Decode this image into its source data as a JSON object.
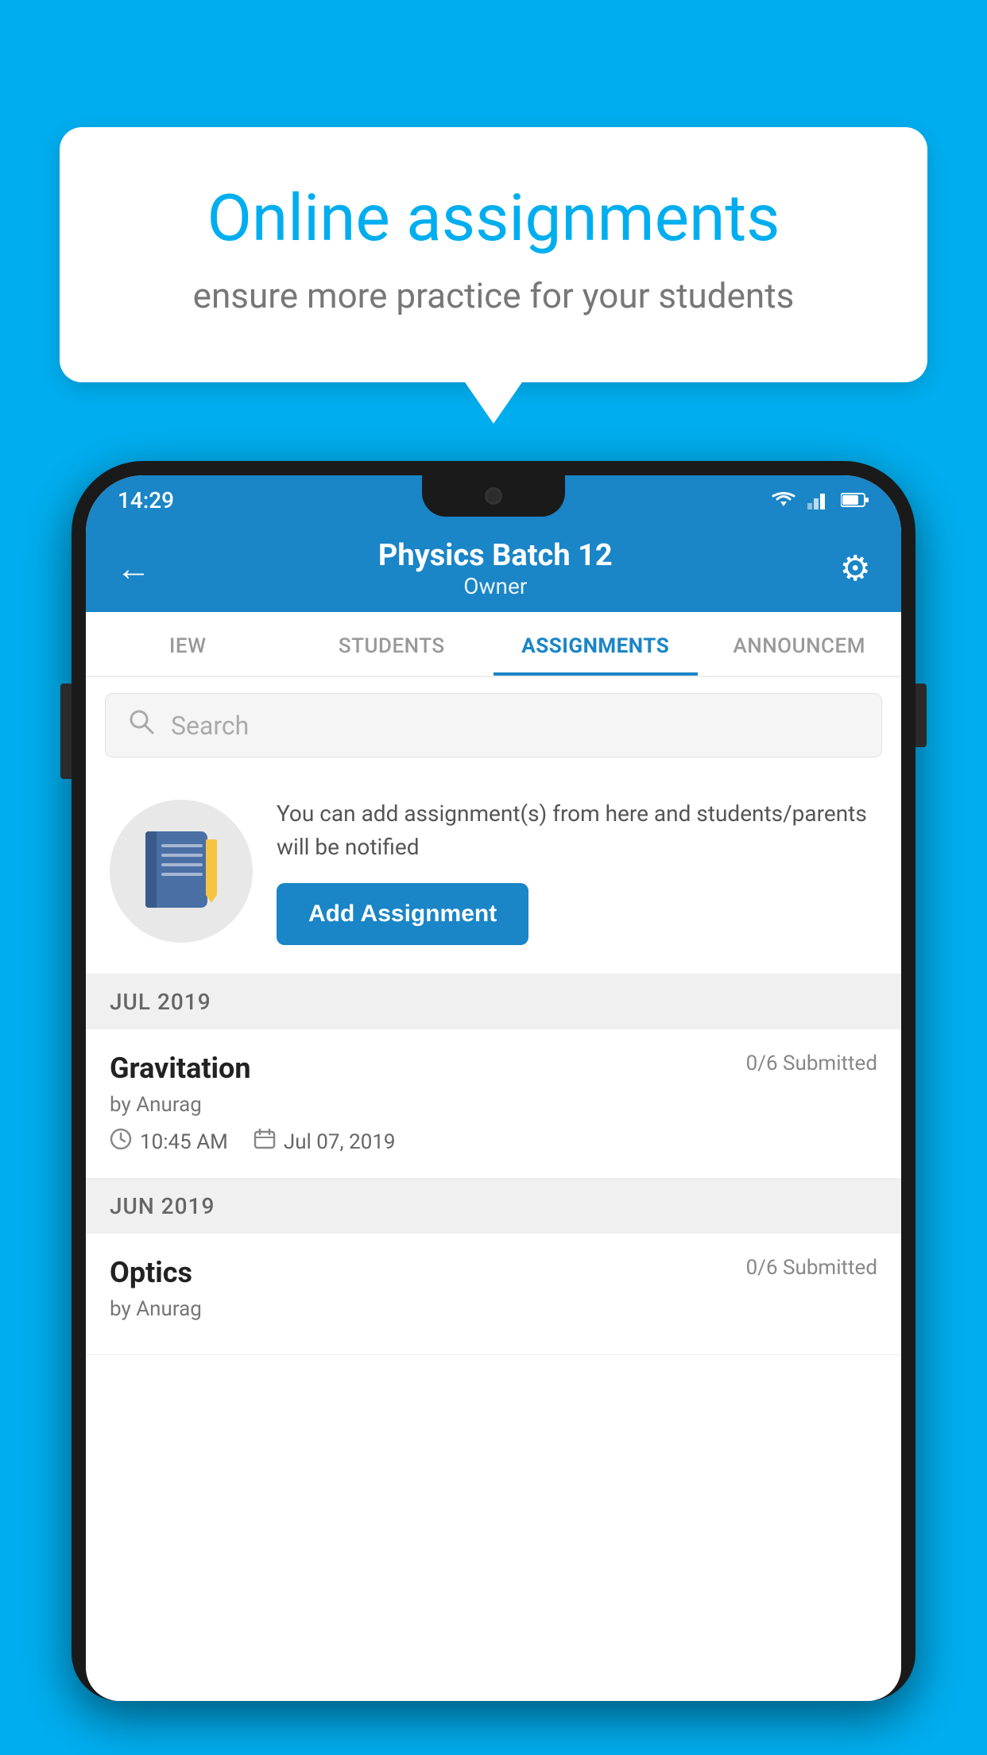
{
  "background_color": "#00AEEF",
  "speech_bubble": {
    "title": "Online assignments",
    "subtitle": "ensure more practice for your students"
  },
  "phone": {
    "status_bar": {
      "time": "14:29"
    },
    "header": {
      "title": "Physics Batch 12",
      "subtitle": "Owner",
      "back_label": "←",
      "settings_label": "⚙"
    },
    "tabs": [
      {
        "label": "IEW",
        "active": false
      },
      {
        "label": "STUDENTS",
        "active": false
      },
      {
        "label": "ASSIGNMENTS",
        "active": true
      },
      {
        "label": "ANNOUNCEM",
        "active": false
      }
    ],
    "search": {
      "placeholder": "Search"
    },
    "promo": {
      "description": "You can add assignment(s) from here and students/parents will be notified",
      "button_label": "Add Assignment"
    },
    "assignments": [
      {
        "month": "JUL 2019",
        "items": [
          {
            "title": "Gravitation",
            "submitted": "0/6 Submitted",
            "author": "by Anurag",
            "time": "10:45 AM",
            "date": "Jul 07, 2019"
          }
        ]
      },
      {
        "month": "JUN 2019",
        "items": [
          {
            "title": "Optics",
            "submitted": "0/6 Submitted",
            "author": "by Anurag",
            "time": "",
            "date": ""
          }
        ]
      }
    ]
  }
}
